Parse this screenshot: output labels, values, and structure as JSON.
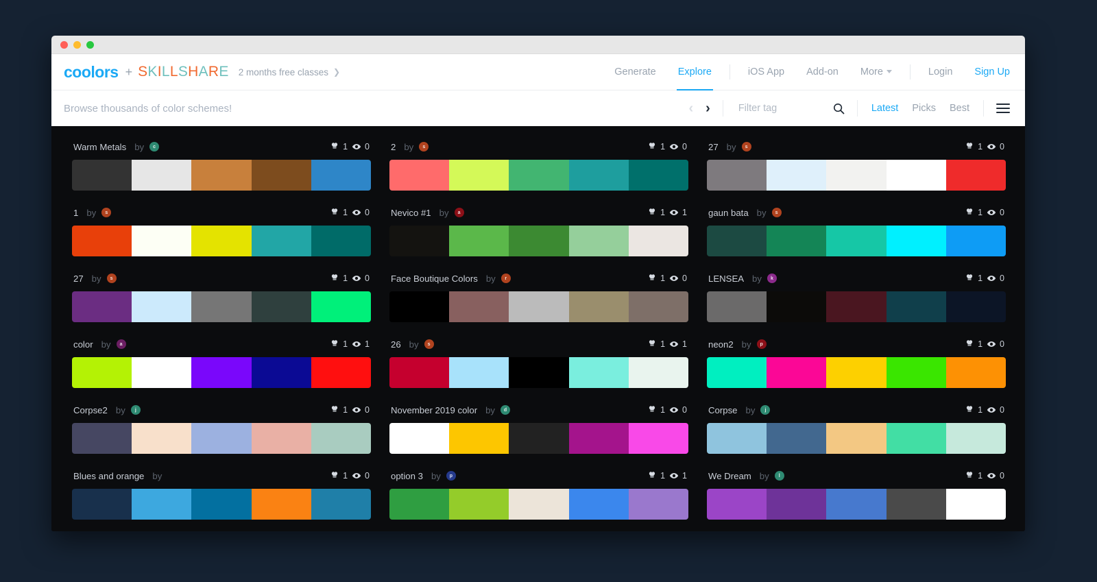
{
  "window": {
    "traffic_lights": [
      "close",
      "minimize",
      "maximize"
    ]
  },
  "header": {
    "logo": "coolors",
    "plus": "+",
    "partner": "SKILLSHARE",
    "promo": "2 months free classes",
    "promo_arrow": "❯",
    "nav_left": [
      {
        "label": "Generate",
        "active": false
      },
      {
        "label": "Explore",
        "active": true
      }
    ],
    "nav_mid": [
      {
        "label": "iOS App",
        "active": false
      },
      {
        "label": "Add-on",
        "active": false
      },
      {
        "label": "More",
        "active": false,
        "caret": true
      }
    ],
    "nav_right": [
      {
        "label": "Login",
        "active": false
      },
      {
        "label": "Sign Up",
        "active": true
      }
    ]
  },
  "filterbar": {
    "browse_text": "Browse thousands of color schemes!",
    "prev_arrow": "‹",
    "next_arrow": "›",
    "tag_placeholder": "Filter tag",
    "tag_value": "",
    "search_icon": "search-icon",
    "sorts": [
      {
        "label": "Latest",
        "active": true
      },
      {
        "label": "Picks",
        "active": false
      },
      {
        "label": "Best",
        "active": false
      }
    ],
    "menu_icon": "hamburger-icon"
  },
  "accents": {
    "brand_blue": "#1ba9f5",
    "skillshare_orange": "#f06a30",
    "skillshare_teal": "#6fc0bd",
    "page_bg": "#0b0c0e",
    "desktop_bg": "#152232"
  },
  "columns": [
    {
      "palettes": [
        {
          "name": "Warm Metals",
          "by": "by",
          "avatar": {
            "letter": "c",
            "color": "#2e8a72"
          },
          "likes": "1",
          "views": "0",
          "colors": [
            "#333333",
            "#e6e6e6",
            "#c8803c",
            "#7d4c1e",
            "#2e86c8"
          ]
        },
        {
          "name": "1",
          "by": "by",
          "avatar": {
            "letter": "s",
            "color": "#b1431f"
          },
          "likes": "1",
          "views": "0",
          "colors": [
            "#e8400a",
            "#fdfff5",
            "#e4e300",
            "#22a6a6",
            "#006b68"
          ]
        },
        {
          "name": "27",
          "by": "by",
          "avatar": {
            "letter": "s",
            "color": "#b1431f"
          },
          "likes": "1",
          "views": "0",
          "colors": [
            "#6b2d82",
            "#cceafc",
            "#767676",
            "#2f403e",
            "#00f07a"
          ]
        },
        {
          "name": "color",
          "by": "by",
          "avatar": {
            "letter": "a",
            "color": "#6b1e62"
          },
          "likes": "1",
          "views": "1",
          "colors": [
            "#b4f205",
            "#ffffff",
            "#7a07fb",
            "#0b0a94",
            "#ff0f0f"
          ]
        },
        {
          "name": "Corpse2",
          "by": "by",
          "avatar": {
            "letter": "j",
            "color": "#2e8a72"
          },
          "likes": "1",
          "views": "0",
          "colors": [
            "#464762",
            "#f8e0cb",
            "#9cb1e0",
            "#e9b0a5",
            "#a9ccc0"
          ]
        },
        {
          "name": "Blues and orange",
          "by": "by",
          "avatar": null,
          "likes": "1",
          "views": "0",
          "colors": [
            "#18304c",
            "#3da8df",
            "#0370a0",
            "#fa8213",
            "#1f7fa8"
          ]
        }
      ]
    },
    {
      "palettes": [
        {
          "name": "2",
          "by": "by",
          "avatar": {
            "letter": "s",
            "color": "#b1431f"
          },
          "likes": "1",
          "views": "0",
          "colors": [
            "#ff6b6b",
            "#d4f958",
            "#42b571",
            "#1e9e9e",
            "#00706b"
          ]
        },
        {
          "name": "Nevico #1",
          "by": "by",
          "avatar": {
            "letter": "a",
            "color": "#8c1018"
          },
          "likes": "1",
          "views": "1",
          "colors": [
            "#141310",
            "#5bb84a",
            "#3c8a32",
            "#95cf9b",
            "#ebe6e2"
          ]
        },
        {
          "name": "Face Boutique Colors",
          "by": "by",
          "avatar": {
            "letter": "r",
            "color": "#b1431f"
          },
          "likes": "1",
          "views": "0",
          "colors": [
            "#000000",
            "#88605f",
            "#bbbbbb",
            "#9a8e6d",
            "#7e6f68"
          ]
        },
        {
          "name": "26",
          "by": "by",
          "avatar": {
            "letter": "s",
            "color": "#b1431f"
          },
          "likes": "1",
          "views": "1",
          "colors": [
            "#c5002e",
            "#a8e2fb",
            "#000000",
            "#7aeede",
            "#e9f4ee"
          ]
        },
        {
          "name": "November 2019 color",
          "by": "by",
          "avatar": {
            "letter": "d",
            "color": "#2e8a72"
          },
          "likes": "1",
          "views": "0",
          "colors": [
            "#ffffff",
            "#fdc600",
            "#222222",
            "#a4148c",
            "#f949e8"
          ]
        },
        {
          "name": "option 3",
          "by": "by",
          "avatar": {
            "letter": "p",
            "color": "#253a8c"
          },
          "likes": "1",
          "views": "1",
          "colors": [
            "#2f9e41",
            "#94cc2a",
            "#ece4d9",
            "#3b87ed",
            "#9a78cd"
          ]
        }
      ]
    },
    {
      "palettes": [
        {
          "name": "27",
          "by": "by",
          "avatar": {
            "letter": "s",
            "color": "#b1431f"
          },
          "likes": "1",
          "views": "0",
          "colors": [
            "#7e7a7e",
            "#dff0fb",
            "#f2f2f0",
            "#ffffff",
            "#ef2b2b"
          ]
        },
        {
          "name": "gaun bata",
          "by": "by",
          "avatar": {
            "letter": "s",
            "color": "#b1431f"
          },
          "likes": "1",
          "views": "0",
          "colors": [
            "#1c4a42",
            "#148556",
            "#16c7a6",
            "#00f0ff",
            "#0e9cf5"
          ]
        },
        {
          "name": "LENSEA",
          "by": "by",
          "avatar": {
            "letter": "k",
            "color": "#8b2a8b"
          },
          "likes": "1",
          "views": "0",
          "colors": [
            "#6b6a6a",
            "#0c0b09",
            "#4a1620",
            "#103f4b",
            "#0c1526"
          ]
        },
        {
          "name": "neon2",
          "by": "by",
          "avatar": {
            "letter": "p",
            "color": "#8c1018"
          },
          "likes": "1",
          "views": "0",
          "colors": [
            "#00efc0",
            "#fb0796",
            "#fdd000",
            "#3ae600",
            "#fd9104"
          ]
        },
        {
          "name": "Corpse",
          "by": "by",
          "avatar": {
            "letter": "j",
            "color": "#2e8a72"
          },
          "likes": "1",
          "views": "0",
          "colors": [
            "#8fc4de",
            "#42688f",
            "#f3c883",
            "#42dea4",
            "#c6e9dc"
          ]
        },
        {
          "name": "We Dream",
          "by": "by",
          "avatar": {
            "letter": "l",
            "color": "#2e8a72"
          },
          "likes": "1",
          "views": "0",
          "colors": [
            "#9b45c7",
            "#6e3399",
            "#4779ce",
            "#4a4a4a",
            "#ffffff"
          ]
        }
      ]
    }
  ]
}
